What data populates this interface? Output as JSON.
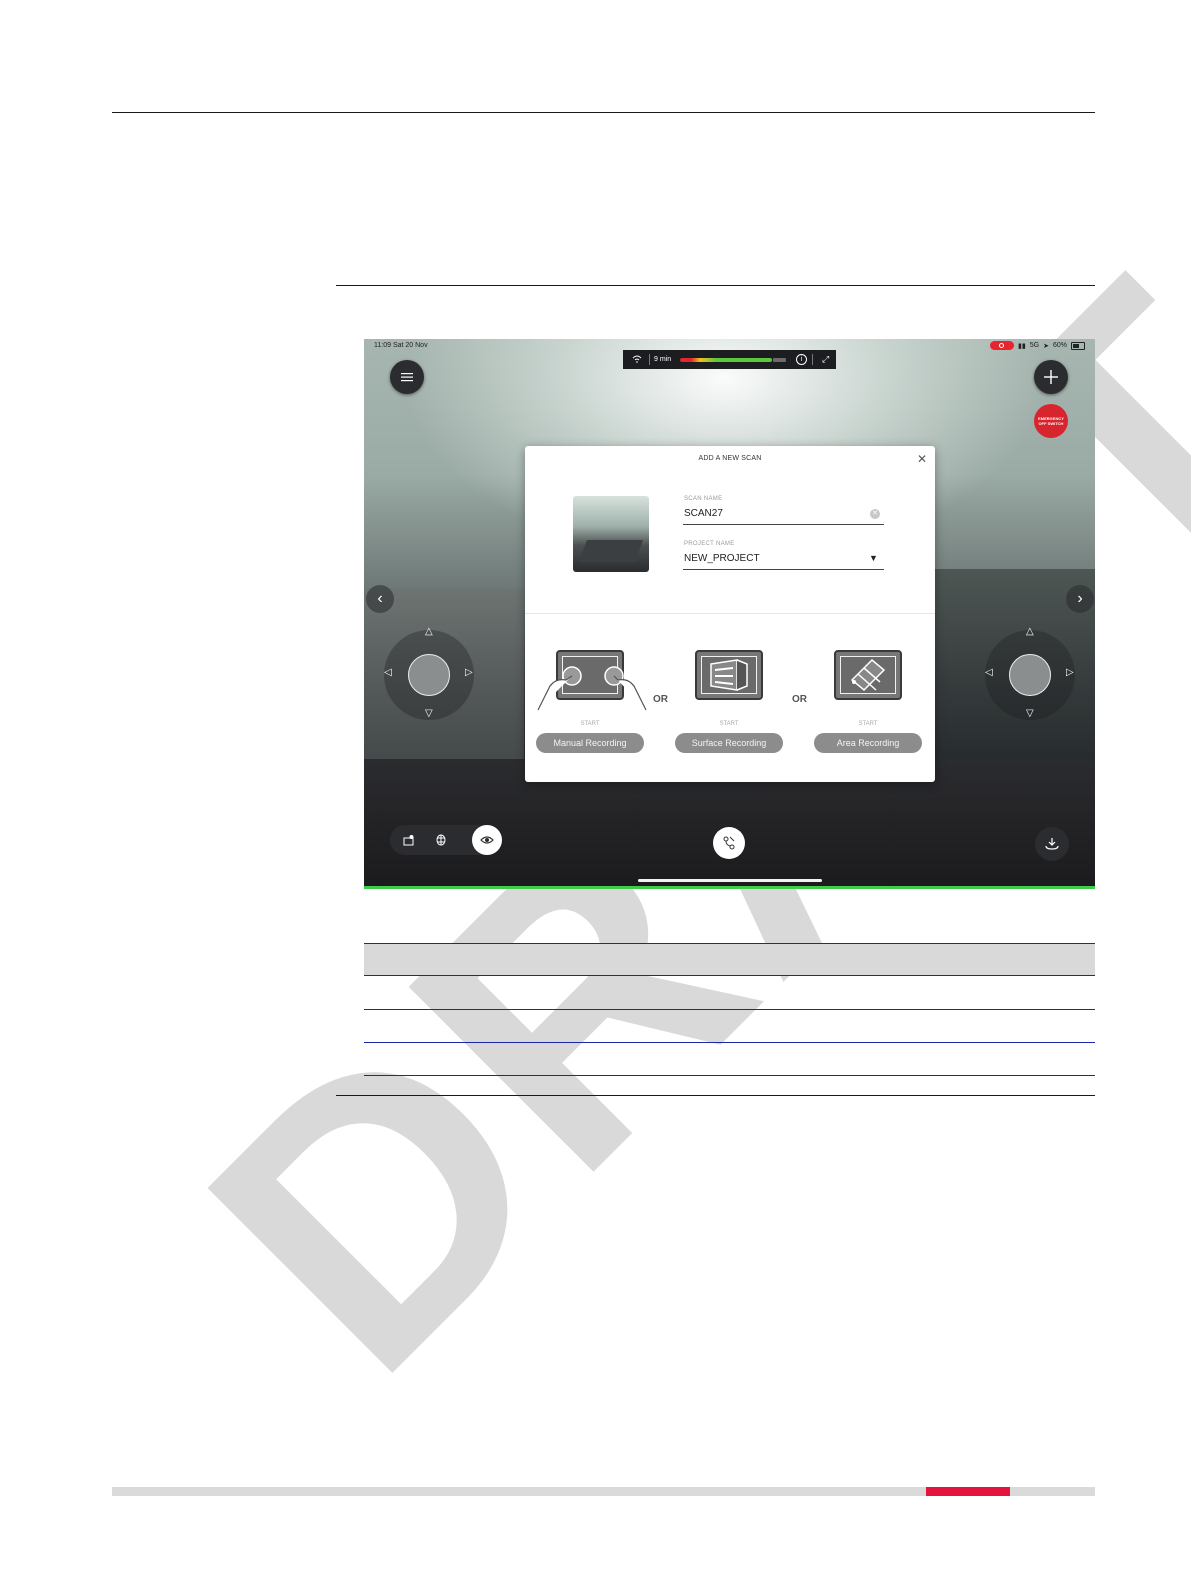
{
  "device": {
    "status_time": "11:09  Sat 20 Nov",
    "status_right": "5G",
    "battery": "60%"
  },
  "topbar": {
    "remaining_time": "9 min",
    "signal_level": 0.88
  },
  "controls": {
    "emergency_label": "EMERGENCY OFF SWITCH"
  },
  "modal": {
    "title": "ADD A NEW SCAN",
    "scan_name_label": "SCAN NAME",
    "scan_name_value": "SCAN27",
    "project_name_label": "PROJECT NAME",
    "project_name_value": "NEW_PROJECT",
    "or_label": "OR",
    "options": [
      {
        "start_label": "START",
        "button_label": "Manual Recording"
      },
      {
        "start_label": "START",
        "button_label": "Surface Recording"
      },
      {
        "start_label": "START",
        "button_label": "Area Recording"
      }
    ]
  },
  "watermark": {
    "text": "DRAFT"
  },
  "colors": {
    "accent_red": "#e2153f",
    "table_rule": "#1a27a8",
    "progress_green": "#5cc63d",
    "emergency_red": "#d8252d"
  }
}
